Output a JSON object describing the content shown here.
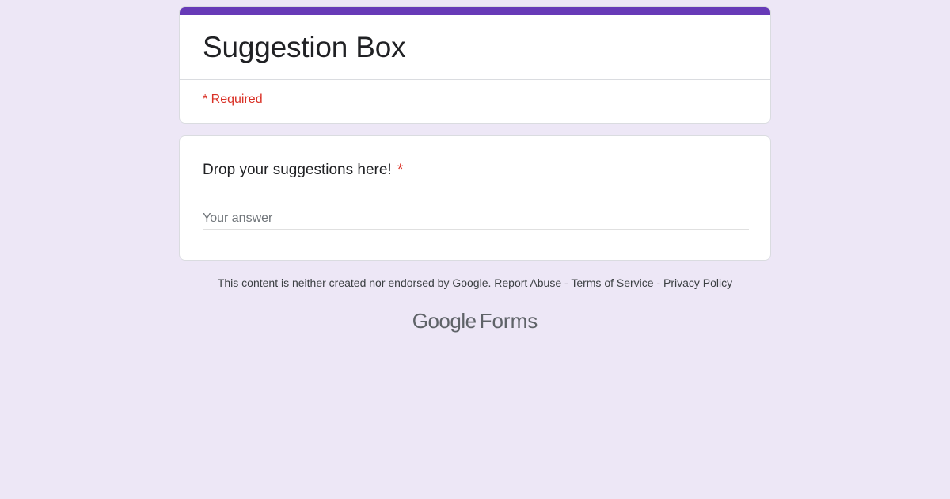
{
  "form": {
    "title": "Suggestion Box",
    "required_note": "* Required",
    "accent_color": "#673ab7",
    "background_color": "#ede7f6"
  },
  "question": {
    "title": "Drop your suggestions here!",
    "required_marker": "*",
    "answer_placeholder": "Your answer",
    "answer_value": ""
  },
  "footer": {
    "disclaimer": "This content is neither created nor endorsed by Google.",
    "links": {
      "report_abuse": "Report Abuse",
      "terms": "Terms of Service",
      "privacy": "Privacy Policy"
    },
    "separator": "-",
    "logo_brand": "Google",
    "logo_product": "Forms"
  }
}
